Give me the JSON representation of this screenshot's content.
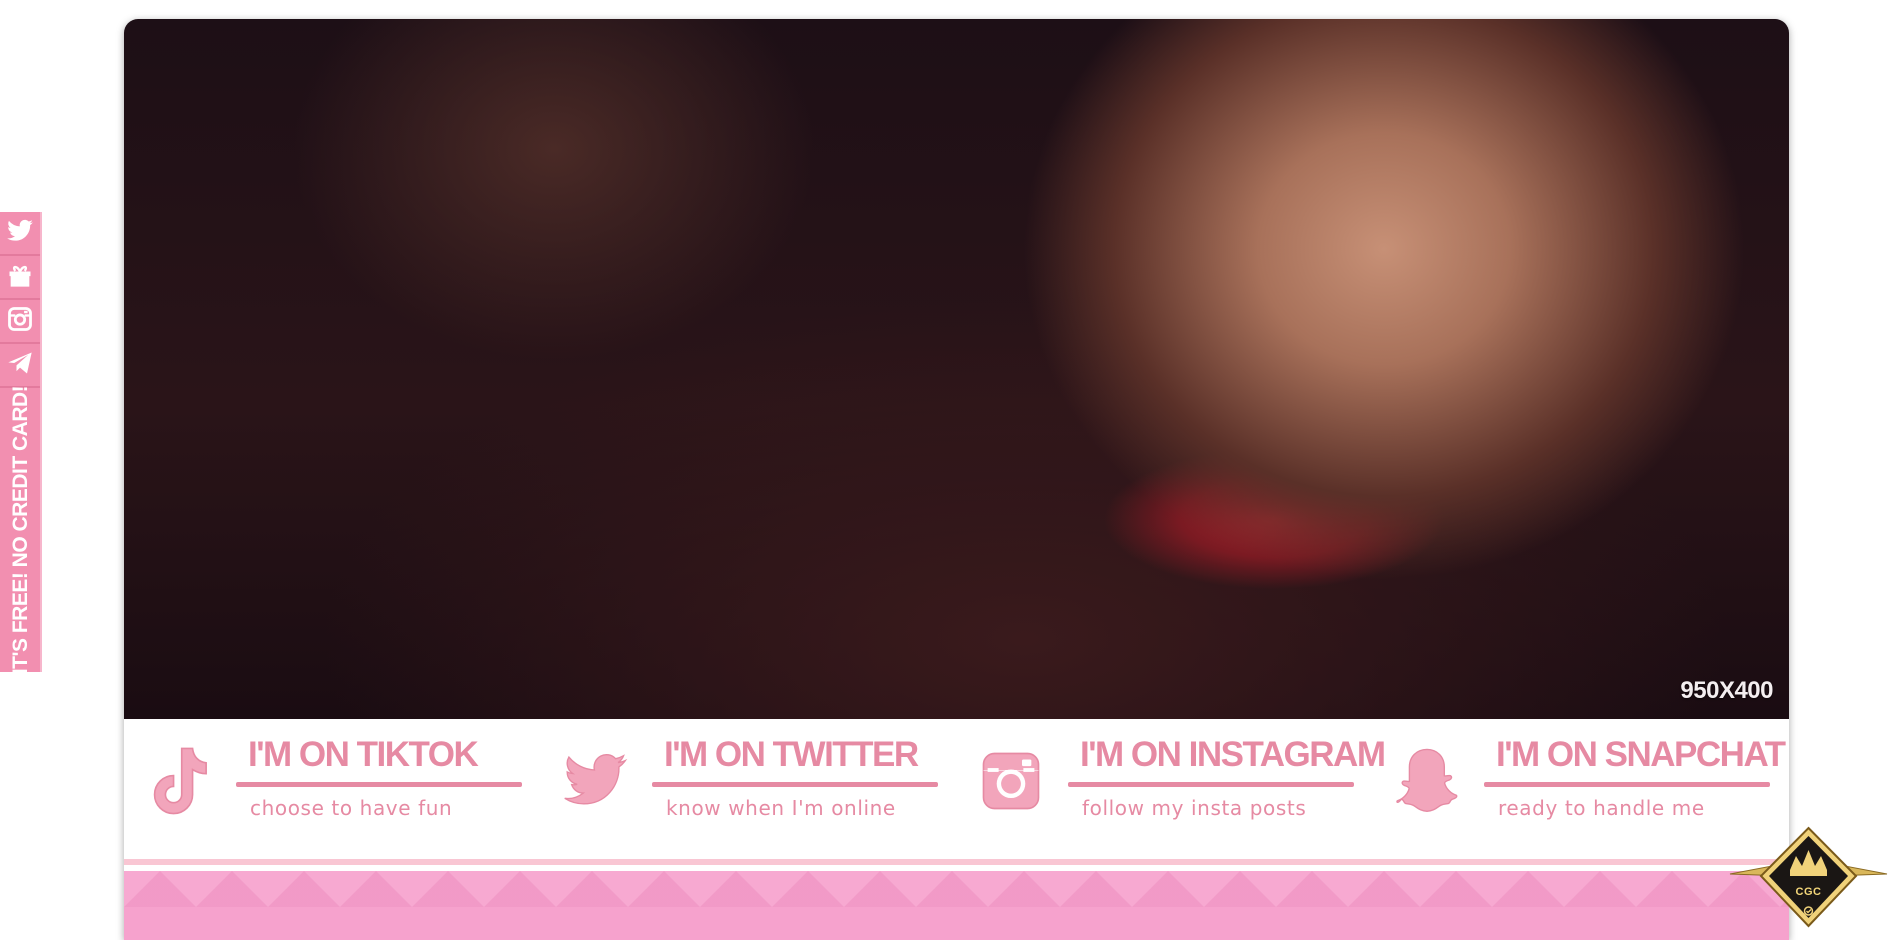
{
  "sidebar": {
    "items": [
      {
        "icon": "twitter-icon"
      },
      {
        "icon": "gift-icon"
      },
      {
        "icon": "instagram-icon"
      },
      {
        "icon": "telegram-icon"
      }
    ],
    "promo_text": "IT'S FREE! NO CREDIT CARD!"
  },
  "hero": {
    "dimension_label": "950X400"
  },
  "socials": [
    {
      "icon": "tiktok-icon",
      "title": "I'M ON TIKTOK",
      "subtitle": "choose to have fun"
    },
    {
      "icon": "twitter-icon",
      "title": "I'M ON TWITTER",
      "subtitle": "know when I'm online"
    },
    {
      "icon": "instagram-icon",
      "title": "I'M ON INSTAGRAM",
      "subtitle": "follow my insta posts"
    },
    {
      "icon": "snapchat-icon",
      "title": "I'M ON SNAPCHAT",
      "subtitle": "ready to handle me"
    }
  ],
  "badge": {
    "text": "CGC"
  },
  "colors": {
    "accent_pink": "#f28fb0",
    "text_pink": "#e68aa3",
    "pattern_pink": "#f6a2cd",
    "badge_gold": "#f4d77a"
  }
}
